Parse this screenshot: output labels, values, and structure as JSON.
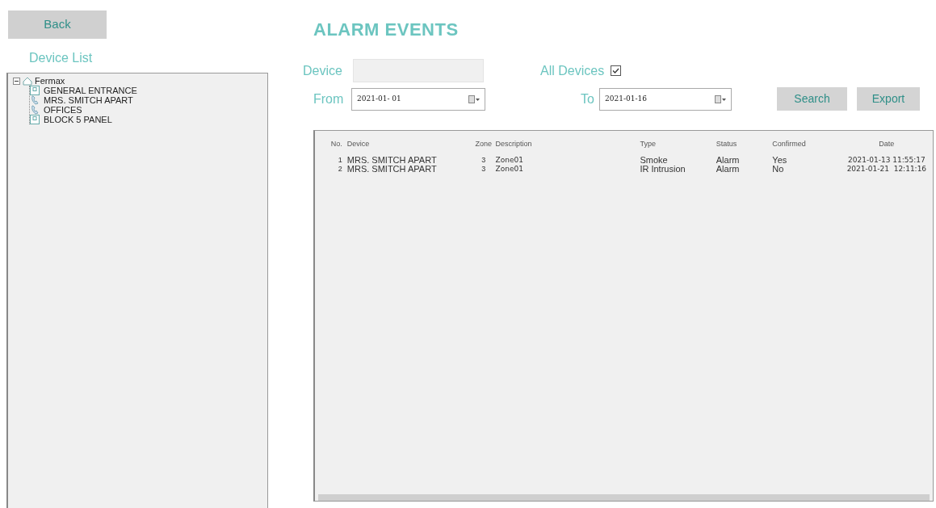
{
  "back_button": "Back",
  "device_list": {
    "title": "Device List",
    "tree": [
      {
        "label": "Fermax",
        "kind": "site",
        "expanded": true,
        "children": [
          {
            "label": "GENERAL ENTRANCE",
            "kind": "panel"
          },
          {
            "label": "MRS. SMITCH APART",
            "kind": "monitor"
          },
          {
            "label": "OFFICES",
            "kind": "monitor"
          },
          {
            "label": "BLOCK 5 PANEL",
            "kind": "panel"
          }
        ]
      }
    ]
  },
  "page_title": "ALARM EVENTS",
  "filters": {
    "device_label": "Device",
    "all_devices_label": "All Devices",
    "all_devices_checked": true,
    "from_label": "From",
    "from_value": "2021-01- 01",
    "to_label": "To",
    "to_value": "2021-01-16"
  },
  "buttons": [
    "Search",
    "Export"
  ],
  "table": {
    "columns": [
      "No.",
      "Device",
      "Zone",
      "Description",
      "Type",
      "Status",
      "Confirmed",
      "Date"
    ],
    "rows": [
      [
        "1",
        "MRS. SMITCH APART",
        "3",
        "Zone01",
        "Smoke",
        "Alarm",
        "Yes",
        "2021-01-13 11:55:17"
      ],
      [
        "2",
        "MRS. SMITCH APART",
        "3",
        "Zone01",
        "IR Intrusion",
        "Alarm",
        "No",
        "2021-01-21  12:11:16"
      ]
    ]
  }
}
